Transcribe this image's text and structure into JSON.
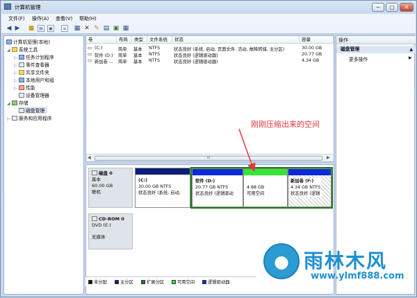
{
  "window": {
    "title": "计算机管理",
    "buttons": {
      "minimize": "─",
      "maximize": "□",
      "close": "✕"
    }
  },
  "menubar": [
    "文件(F)",
    "操作(A)",
    "查看(V)",
    "帮助(H)"
  ],
  "toolbar_icons": [
    "back-arrow-icon",
    "forward-arrow-icon",
    "up-folder-icon",
    "show-tree-icon",
    "console-icon",
    "list-icon",
    "close-x-icon",
    "properties-icon",
    "refresh-icon",
    "export-icon",
    "help-icon"
  ],
  "tree": {
    "root": "计算机管理(本地)",
    "system_tools": "系统工具",
    "task_scheduler": "任务计划程序",
    "event_viewer": "事件查看器",
    "shared_folders": "共享文件夹",
    "local_users": "本地用户和组",
    "performance": "性能",
    "device_manager": "设备管理器",
    "storage": "存储",
    "disk_management": "磁盘管理",
    "services": "服务和应用程序"
  },
  "volume_table": {
    "headers": [
      "卷",
      "布局",
      "类型",
      "文件系统",
      "状态",
      "容量"
    ],
    "rows": [
      [
        "(C:)",
        "简单",
        "基本",
        "NTFS",
        "状态良好 (系统, 启动, 页面文件, 活动, 故障转储, 主分区)",
        "30.00 GB"
      ],
      [
        "软件 (D:)",
        "简单",
        "基本",
        "NTFS",
        "状态良好 (逻辑驱动器)",
        "20.77 GB"
      ],
      [
        "新加卷 ...",
        "简单",
        "基本",
        "NTFS",
        "状态良好 (逻辑驱动器)",
        "4.34 GB"
      ]
    ]
  },
  "scrollbar_grip": "III",
  "disk0": {
    "name": "磁盘 0",
    "type": "基本",
    "size": "60.00 GB",
    "status": "联机",
    "partitions": [
      {
        "title": "(C:)",
        "size": "30.00 GB NTFS",
        "status": "状态良好 (系统, 启动,",
        "color": "#0a1f7a"
      },
      {
        "title": "软件 (D:)",
        "size": "20.77 GB NTFS",
        "status": "状态良好 (逻辑驱动",
        "color": "#0b2bd4"
      },
      {
        "title": "",
        "size": "4.88 GB",
        "status": "可用空间",
        "color": "#33e633"
      },
      {
        "title": "新加卷 (F:)",
        "size": "4.34 GB NTFS",
        "status": "状态良好 (逻辑",
        "color": "#0b2bd4"
      }
    ]
  },
  "cdrom": {
    "name": "CD-ROM 0",
    "type": "DVD (E:)",
    "media": "无媒体"
  },
  "legend": [
    {
      "label": "未分配",
      "color": "#111111"
    },
    {
      "label": "主分区",
      "color": "#0a1f7a"
    },
    {
      "label": "扩展分区",
      "color": "#1f7a1f"
    },
    {
      "label": "可用空间",
      "color": "#33e633"
    },
    {
      "label": "逻辑驱动器",
      "color": "#0b2bd4"
    }
  ],
  "actions": {
    "header": "操作",
    "section": "磁盘管理",
    "more": "更多操作"
  },
  "annotation": "刚刚压缩出来的空间",
  "watermark": {
    "title": "雨林木风",
    "url": "www.ylmf888.com"
  }
}
